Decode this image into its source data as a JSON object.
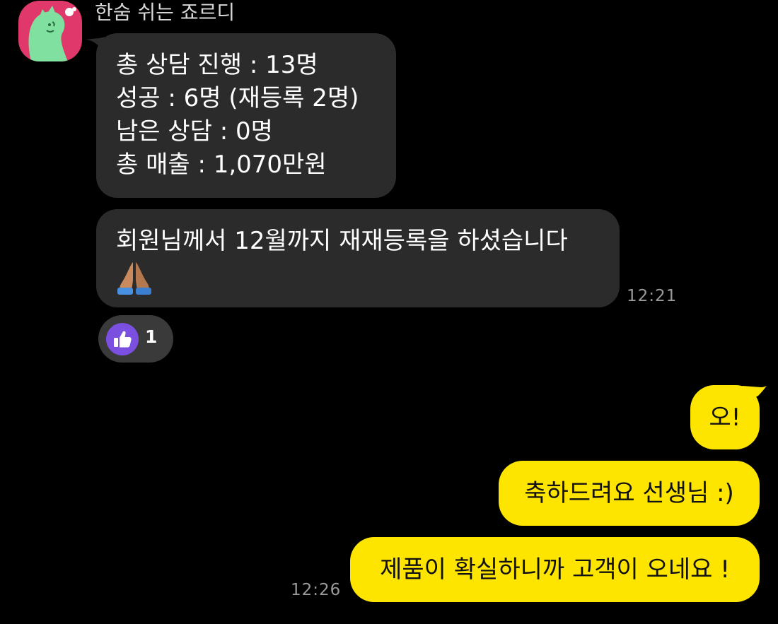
{
  "chat": {
    "sender_name": "한숨 쉬는 죠르디",
    "avatar_icon": "jordy-dinosaur-avatar",
    "incoming": {
      "message1_lines": [
        "총 상담 진행 : 13명",
        "성공 : 6명 (재등록 2명)",
        "남은 상담 : 0명",
        "총 매출 : 1,070만원"
      ],
      "message2_text": "회원님께서 12월까지 재재등록을 하셨습니다",
      "message2_emoji": "folded-hands-emoji",
      "time": "12:21",
      "reaction": {
        "icon": "thumbs-up-icon",
        "count": "1"
      }
    },
    "outgoing": {
      "messages": [
        "오!",
        "축하드려요 선생님 :)",
        "제품이 확실하니까 고객이 오네요 !"
      ],
      "time": "12:26"
    }
  },
  "colors": {
    "background": "#000000",
    "incoming_bubble": "#2b2b2b",
    "outgoing_bubble": "#fee500",
    "avatar_bg": "#e0386a",
    "reaction_accent": "#7b4fe0",
    "timestamp": "#9a9a9a"
  }
}
